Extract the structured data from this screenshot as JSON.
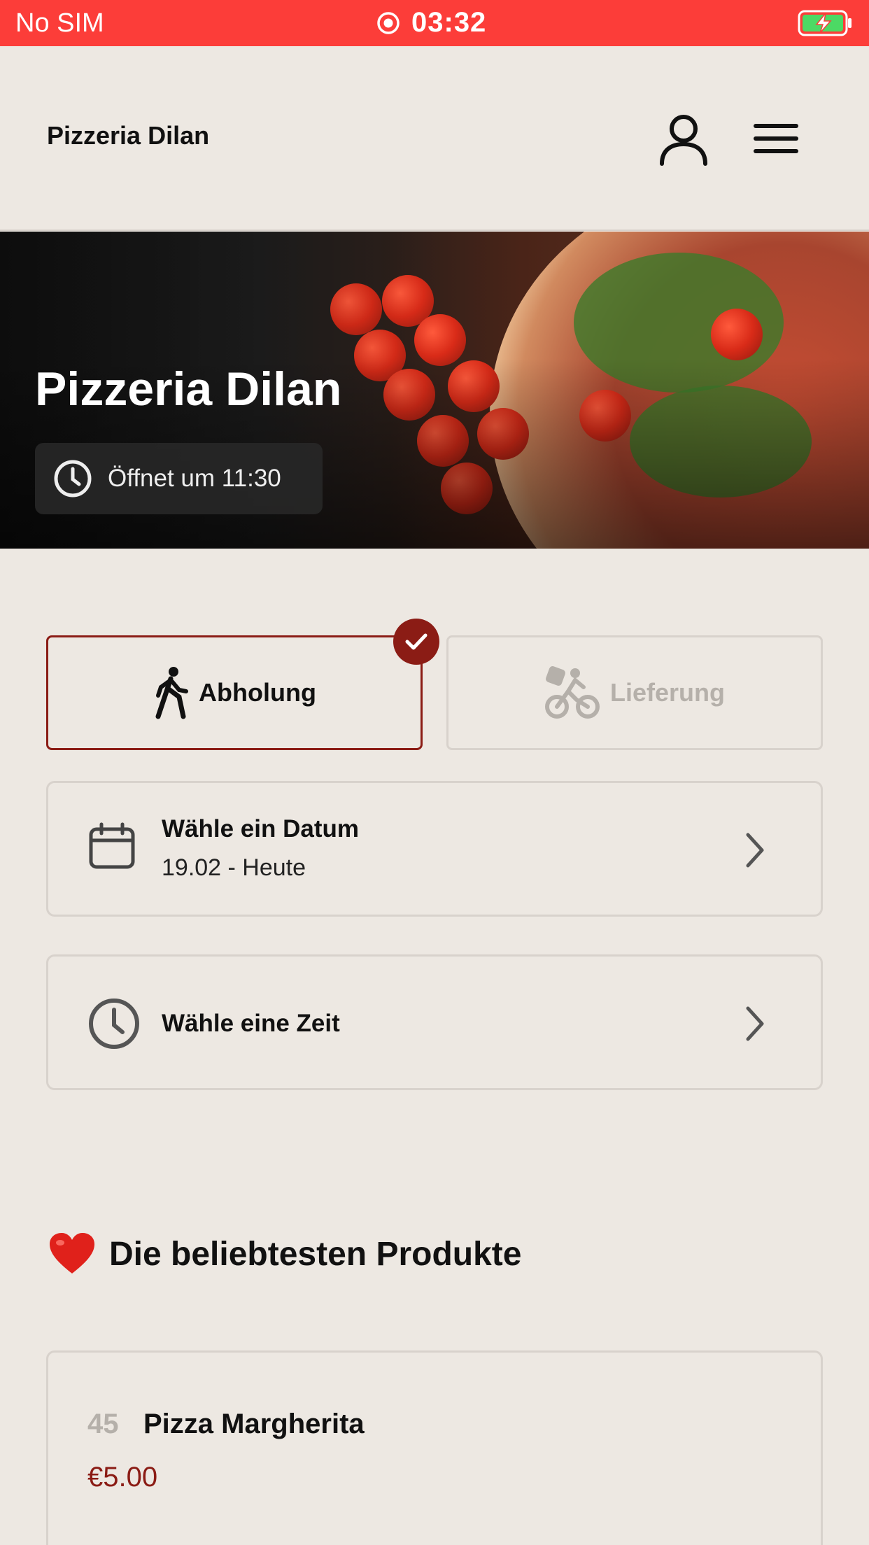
{
  "status_bar": {
    "carrier": "No SIM",
    "time": "03:32"
  },
  "header": {
    "brand": "Pizzeria Dilan",
    "user_icon": "user-icon",
    "menu_icon": "hamburger-menu-icon"
  },
  "hero": {
    "title": "Pizzeria Dilan",
    "hours_text": "Öffnet um 11:30"
  },
  "order_mode": {
    "pickup_label": "Abholung",
    "delivery_label": "Lieferung",
    "selected": "pickup"
  },
  "date_selector": {
    "label": "Wähle ein Datum",
    "value": "19.02 - Heute"
  },
  "time_selector": {
    "label": "Wähle eine Zeit"
  },
  "popular": {
    "title": "Die beliebtesten Produkte",
    "products": [
      {
        "number": "45",
        "name": "Pizza Margherita",
        "price": "€5.00"
      }
    ]
  },
  "colors": {
    "status_bar": "#fc3d39",
    "background": "#ede8e2",
    "accent": "#8b1c15",
    "muted": "#b5b0aa"
  }
}
